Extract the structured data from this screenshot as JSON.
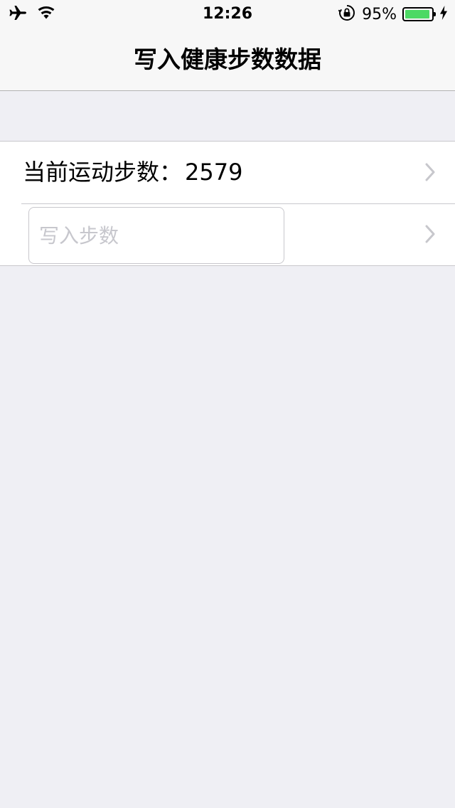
{
  "status_bar": {
    "time": "12:26",
    "battery_percent": "95%",
    "battery_level": 0.95,
    "icons": [
      "airplane-icon",
      "wifi-icon",
      "rotation-lock-icon",
      "charging-bolt-icon"
    ],
    "battery_color": "#4cd964"
  },
  "nav": {
    "title": "写入健康步数数据"
  },
  "table": {
    "rows": [
      {
        "label": "当前运动步数：",
        "value": "2579"
      },
      {
        "input_placeholder": "写入步数",
        "input_value": ""
      }
    ]
  },
  "colors": {
    "background": "#efeff4",
    "separator": "#c8c7cc",
    "chevron": "#c7c7cc"
  }
}
